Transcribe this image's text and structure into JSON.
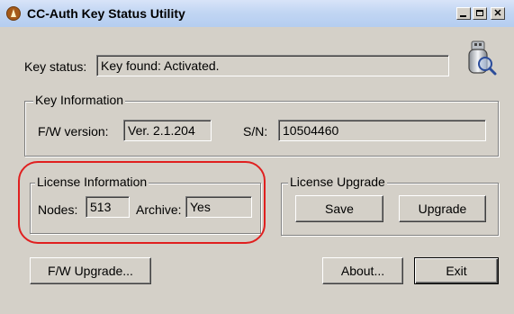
{
  "window": {
    "title": "CC-Auth Key Status Utility"
  },
  "status": {
    "label": "Key status:",
    "value": "Key found: Activated."
  },
  "key_info": {
    "title": "Key Information",
    "fw_label": "F/W version:",
    "fw_value": "Ver. 2.1.204",
    "sn_label": "S/N:",
    "sn_value": "10504460"
  },
  "license_info": {
    "title": "License Information",
    "nodes_label": "Nodes:",
    "nodes_value": "513",
    "archive_label": "Archive:",
    "archive_value": "Yes"
  },
  "license_upgrade": {
    "title": "License Upgrade",
    "save_label": "Save",
    "upgrade_label": "Upgrade"
  },
  "buttons": {
    "fw_upgrade": "F/W Upgrade...",
    "about": "About...",
    "exit": "Exit"
  },
  "colors": {
    "highlight": "#e01f1f",
    "titlebar": "#c2d6f3",
    "face": "#d4d0c8"
  },
  "icons": {
    "app": "app-logo-icon",
    "key": "usb-key-magnifier-icon"
  }
}
